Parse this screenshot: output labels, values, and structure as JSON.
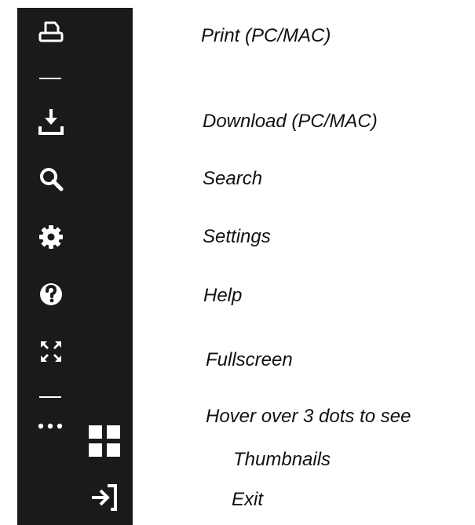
{
  "toolbar": {
    "background": "#1a1a1a",
    "icon_color": "#ffffff",
    "items": [
      {
        "icon": "printer-icon"
      },
      {
        "icon": "download-icon"
      },
      {
        "icon": "search-icon"
      },
      {
        "icon": "gear-icon"
      },
      {
        "icon": "help-icon"
      },
      {
        "icon": "fullscreen-icon"
      },
      {
        "icon": "more-dots-icon"
      },
      {
        "icon": "thumbnails-grid-icon"
      },
      {
        "icon": "exit-icon"
      }
    ]
  },
  "legend": {
    "print": "Print (PC/MAC)",
    "download": "Download (PC/MAC)",
    "search": "Search",
    "settings": "Settings",
    "help": "Help",
    "fullscreen": "Fullscreen",
    "hover_hint": "Hover over 3 dots to see",
    "thumbnails": "Thumbnails",
    "exit": "Exit"
  }
}
